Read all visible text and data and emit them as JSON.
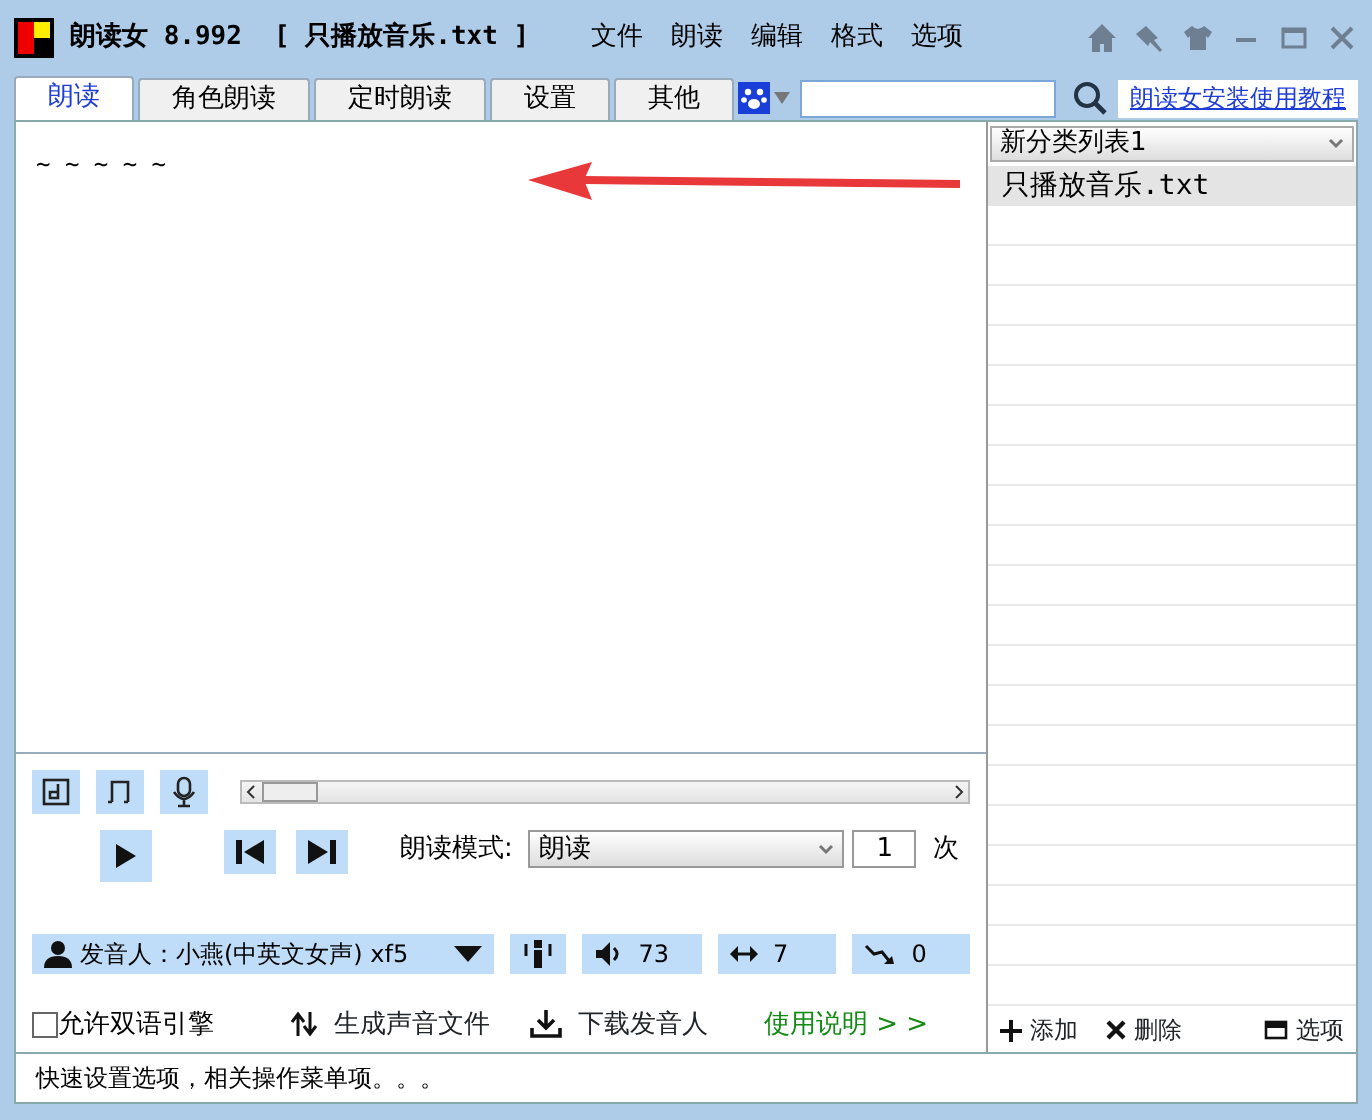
{
  "window": {
    "title": "朗读女 8.992",
    "document": "[ 只播放音乐.txt ]"
  },
  "menu": [
    "文件",
    "朗读",
    "编辑",
    "格式",
    "选项"
  ],
  "tabs": [
    {
      "label": "朗读",
      "selected": true
    },
    {
      "label": "角色朗读",
      "selected": false
    },
    {
      "label": "定时朗读",
      "selected": false
    },
    {
      "label": "设置",
      "selected": false
    },
    {
      "label": "其他",
      "selected": false
    }
  ],
  "help_link": "朗读女安装使用教程",
  "editor": {
    "text": "~ ~ ~ ~ ~"
  },
  "list_panel": {
    "category": "新分类列表1",
    "items": [
      {
        "label": "只播放音乐.txt",
        "selected": true
      }
    ],
    "actions": [
      "添加",
      "删除",
      "选项"
    ]
  },
  "player": {
    "mode_label": "朗读模式:",
    "mode": "朗读",
    "repeat": "1",
    "repeat_unit": "次"
  },
  "voice": {
    "speaker": "发音人：小燕(中英文女声) xf5",
    "volume": "73",
    "speed": "7",
    "pitch": "0"
  },
  "options": {
    "bilingual": {
      "label": "允许双语引擎",
      "checked": false
    },
    "generate": "生成声音文件",
    "download": "下载发音人",
    "help": "使用说明 > >"
  },
  "status_bar": "快速设置选项，相关操作菜单项。。。"
}
